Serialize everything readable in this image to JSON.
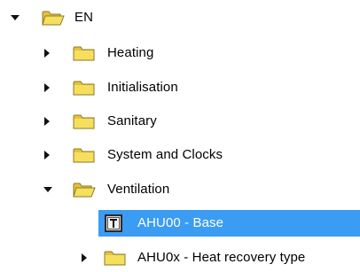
{
  "tree": {
    "root": {
      "label": "EN",
      "expanded": true
    },
    "items": [
      {
        "label": "Heating",
        "expanded": false
      },
      {
        "label": "Initialisation",
        "expanded": false
      },
      {
        "label": "Sanitary",
        "expanded": false
      },
      {
        "label": "System and Clocks",
        "expanded": false
      },
      {
        "label": "Ventilation",
        "expanded": true
      }
    ],
    "ventilation_children": [
      {
        "label": "AHU00 - Base",
        "selected": true,
        "type": "template"
      },
      {
        "label": "AHU0x - Heat recovery type",
        "expanded": false,
        "type": "folder"
      }
    ]
  },
  "colors": {
    "selection": "#3a9cf3",
    "folder_fill": "#f3d64a",
    "folder_edge": "#8a7a2a"
  }
}
